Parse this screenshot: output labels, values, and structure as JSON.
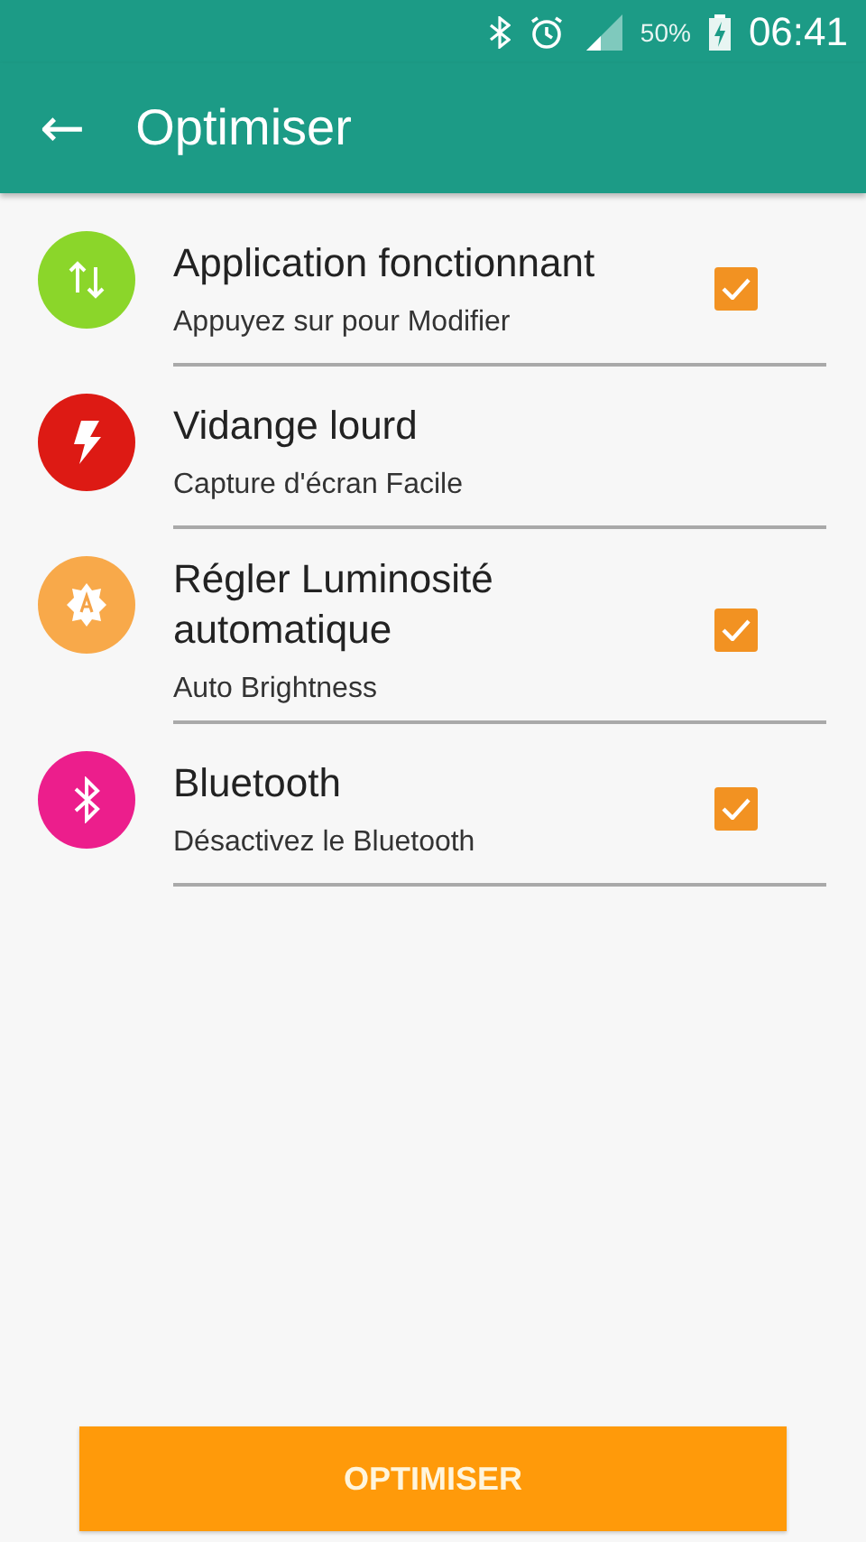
{
  "status_bar": {
    "battery": "50%",
    "time": "06:41"
  },
  "header": {
    "back": "←",
    "title": "Optimiser"
  },
  "items": [
    {
      "title": "Application fonctionnant",
      "subtitle": "Appuyez sur pour Modifier",
      "kind": "arrows",
      "color": "#8bd62a",
      "checked": true
    },
    {
      "title": "Vidange lourd",
      "subtitle": "Capture d'écran Facile",
      "kind": "bolt",
      "color": "#dd1a14",
      "checked": false
    },
    {
      "title": "Régler Luminosité automatique",
      "subtitle": "Auto Brightness",
      "kind": "brightness",
      "color": "#f8a94a",
      "checked": true
    },
    {
      "title": "Bluetooth",
      "subtitle": "Désactivez le Bluetooth",
      "kind": "bluetooth",
      "color": "#ec1e8c",
      "checked": true
    }
  ],
  "button": "OPTIMISER"
}
